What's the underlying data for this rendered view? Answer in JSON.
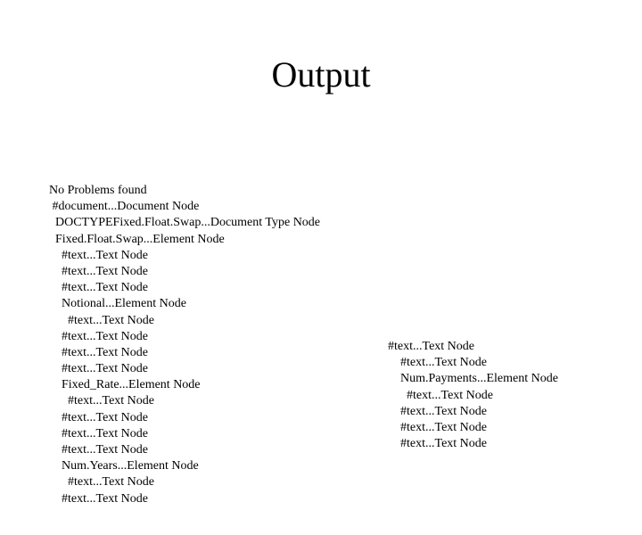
{
  "title": "Output",
  "left_lines": [
    "No Problems found",
    " #document...Document Node",
    "  DOCTYPEFixed.Float.Swap...Document Type Node",
    "  Fixed.Float.Swap...Element Node",
    "    #text...Text Node",
    "    #text...Text Node",
    "    #text...Text Node",
    "    Notional...Element Node",
    "      #text...Text Node",
    "    #text...Text Node",
    "    #text...Text Node",
    "    #text...Text Node",
    "    Fixed_Rate...Element Node",
    "      #text...Text Node",
    "    #text...Text Node",
    "    #text...Text Node",
    "    #text...Text Node",
    "    Num.Years...Element Node",
    "      #text...Text Node",
    "    #text...Text Node"
  ],
  "right_lines": [
    "#text...Text Node",
    "    #text...Text Node",
    "    Num.Payments...Element Node",
    "      #text...Text Node",
    "    #text...Text Node",
    "    #text...Text Node",
    "    #text...Text Node"
  ]
}
